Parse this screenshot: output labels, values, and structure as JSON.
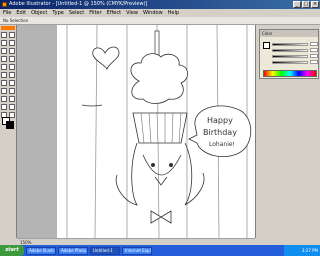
{
  "window": {
    "title": "Adobe Illustrator - [Untitled-1 @ 150% (CMYK/Preview)]",
    "controls": [
      "_",
      "□",
      "×"
    ]
  },
  "menu": {
    "items": [
      "File",
      "Edit",
      "Object",
      "Type",
      "Select",
      "Filter",
      "Effect",
      "View",
      "Window",
      "Help"
    ]
  },
  "control_bar": {
    "text": "No Selection"
  },
  "panel": {
    "tab": "Color"
  },
  "statusbar": {
    "zoom": "150%"
  },
  "drawing": {
    "speech_bubble_lines": [
      "Happy",
      "Birthday",
      "Lohanie!"
    ]
  },
  "taskbar": {
    "start_label": "start",
    "tasks": [
      "Adobe Illustr...",
      "Adobe Photo...",
      "Untitled-1",
      "Internet Expl..."
    ],
    "clock": "3:27 PM"
  },
  "colors": {
    "title_gradient_start": "#0a246a",
    "taskbar": "#245edb",
    "start_button": "#3c9a3c",
    "toolbox_grip": "#ff7a00"
  },
  "icons": {
    "app": "illustrator-app-icon",
    "fill_swatch": "fill-swatch-icon",
    "stroke_swatch": "stroke-swatch-icon"
  }
}
